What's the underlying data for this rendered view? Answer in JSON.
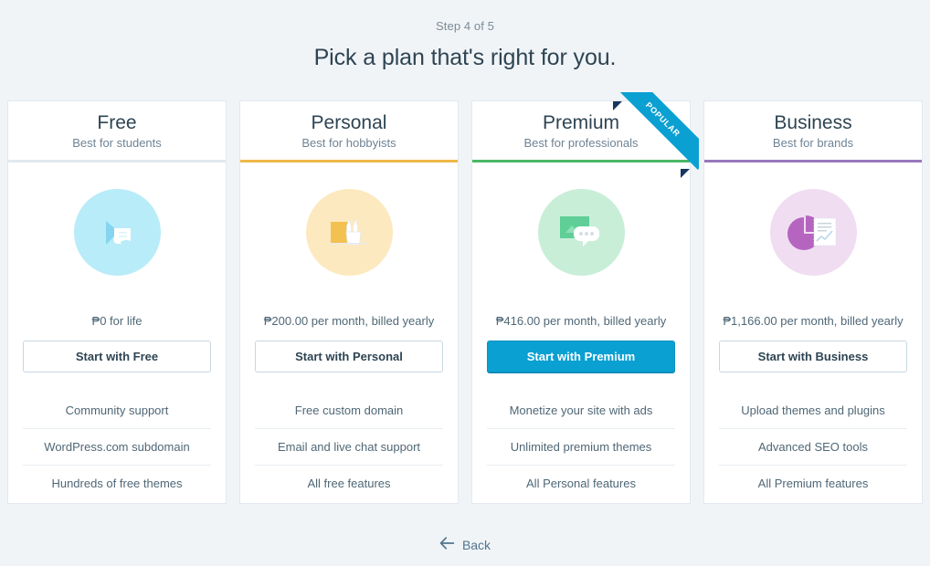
{
  "header": {
    "step_label": "Step 4 of 5",
    "title": "Pick a plan that's right for you."
  },
  "ribbon": {
    "label": "POPULAR"
  },
  "plans": [
    {
      "name": "Free",
      "tagline": "Best for students",
      "accent": "#e2e9ef",
      "circle_color": "#b8ecf8",
      "icon": "cursor-document-icon",
      "price": "₱0 for life",
      "button_label": "Start with Free",
      "button_style": "outline",
      "features": [
        "Community support",
        "WordPress.com subdomain",
        "Hundreds of free themes"
      ]
    },
    {
      "name": "Personal",
      "tagline": "Best for hobbyists",
      "accent": "#f0b849",
      "circle_color": "#fde9bf",
      "icon": "pencil-cup-icon",
      "price": "₱200.00 per month, billed yearly",
      "button_label": "Start with Personal",
      "button_style": "outline",
      "features": [
        "Free custom domain",
        "Email and live chat support",
        "All free features"
      ]
    },
    {
      "name": "Premium",
      "tagline": "Best for professionals",
      "accent": "#4ab866",
      "circle_color": "#c8eed8",
      "icon": "speech-bubble-icon",
      "price": "₱416.00 per month, billed yearly",
      "button_label": "Start with Premium",
      "button_style": "primary",
      "popular": true,
      "features": [
        "Monetize your site with ads",
        "Unlimited premium themes",
        "All Personal features"
      ]
    },
    {
      "name": "Business",
      "tagline": "Best for brands",
      "accent": "#9778bd",
      "circle_color": "#f0ddf2",
      "icon": "pie-chart-report-icon",
      "price": "₱1,166.00 per month, billed yearly",
      "button_label": "Start with Business",
      "button_style": "outline",
      "features": [
        "Upload themes and plugins",
        "Advanced SEO tools",
        "All Premium features"
      ]
    }
  ],
  "footer": {
    "back_label": "Back"
  }
}
